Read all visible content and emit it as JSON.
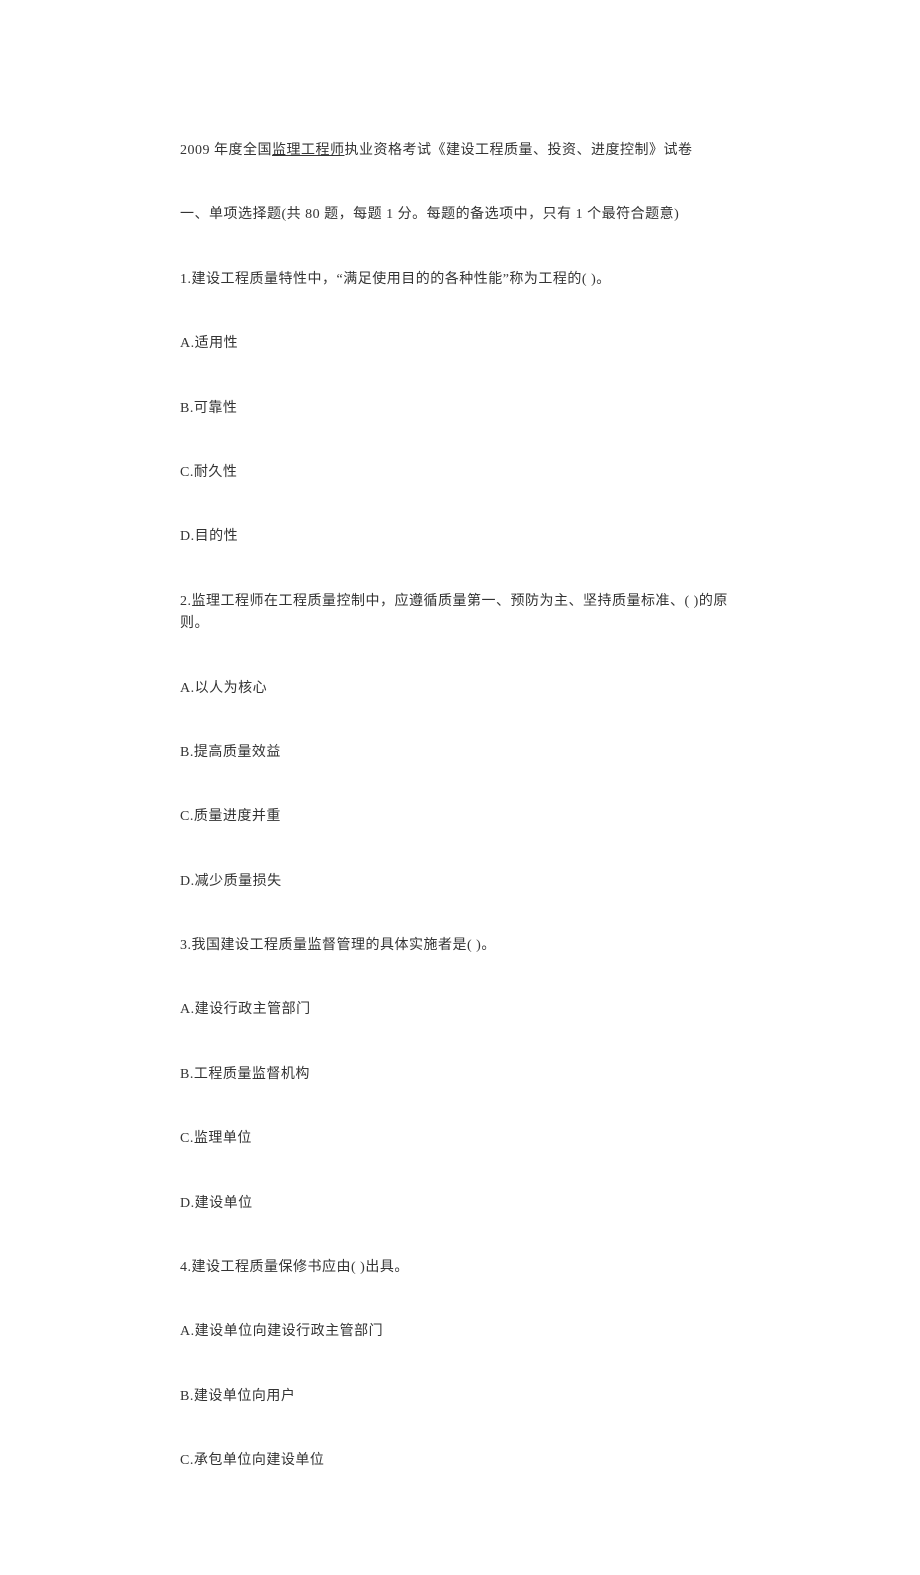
{
  "title": {
    "prefix": "2009 年度全国",
    "underlined": "监理工程师",
    "suffix": "执业资格考试《建设工程质量、投资、进度控制》试卷"
  },
  "section": "一、单项选择题(共 80 题，每题 1 分。每题的备选项中，只有 1 个最符合题意)",
  "questions": [
    {
      "text": "1.建设工程质量特性中，“满足使用目的的各种性能”称为工程的( )。",
      "options": [
        "A.适用性",
        "B.可靠性",
        "C.耐久性",
        "D.目的性"
      ]
    },
    {
      "text": "2.监理工程师在工程质量控制中，应遵循质量第一、预防为主、坚持质量标准、( )的原则。",
      "options": [
        "A.以人为核心",
        "B.提高质量效益",
        "C.质量进度并重",
        "D.减少质量损失"
      ]
    },
    {
      "text": "3.我国建设工程质量监督管理的具体实施者是( )。",
      "options": [
        "A.建设行政主管部门",
        "B.工程质量监督机构",
        "C.监理单位",
        "D.建设单位"
      ]
    },
    {
      "text": "4.建设工程质量保修书应由( )出具。",
      "options": [
        "A.建设单位向建设行政主管部门",
        "B.建设单位向用户",
        "C.承包单位向建设单位"
      ]
    }
  ]
}
